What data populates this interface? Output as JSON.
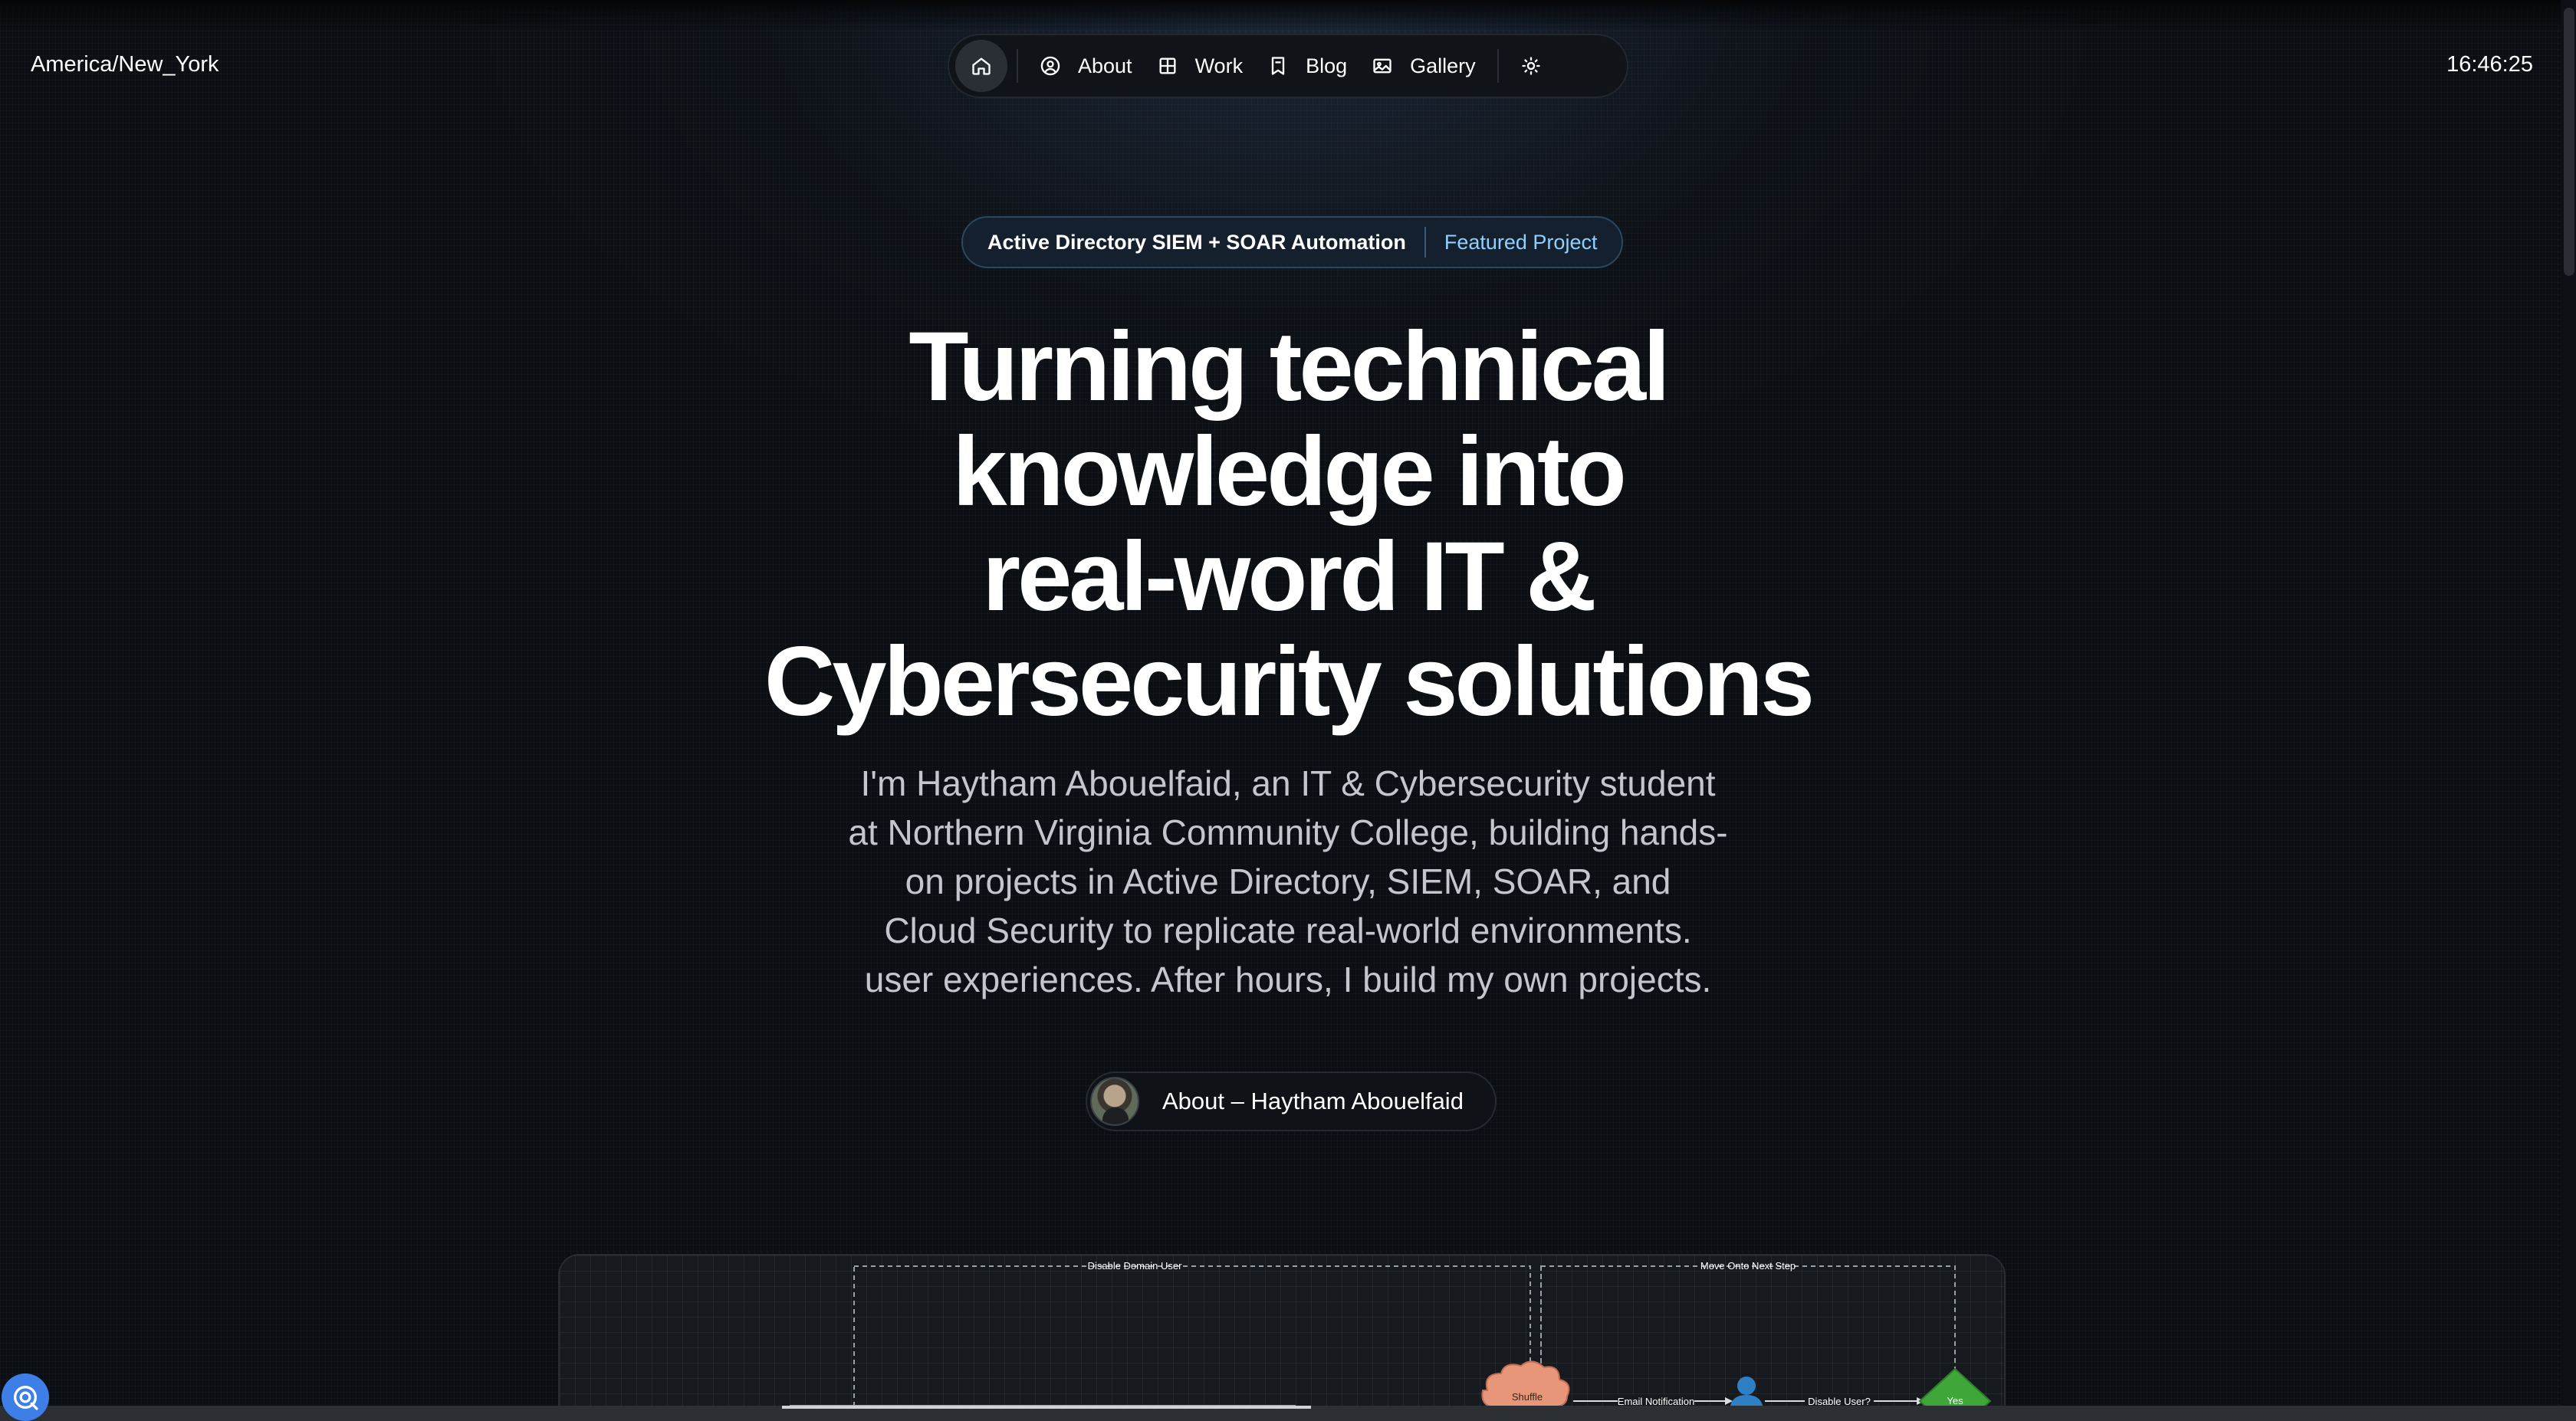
{
  "header": {
    "timezone": "America/New_York",
    "clock": "16:46:25"
  },
  "nav": {
    "items": [
      {
        "label": "About",
        "icon": "user-circle-icon"
      },
      {
        "label": "Work",
        "icon": "grid-icon"
      },
      {
        "label": "Blog",
        "icon": "book-icon"
      },
      {
        "label": "Gallery",
        "icon": "image-icon"
      }
    ],
    "home_icon": "home-icon",
    "theme_icon": "sun-icon"
  },
  "badge": {
    "title": "Active Directory SIEM + SOAR Automation",
    "tag": "Featured Project"
  },
  "hero": {
    "title_lines": [
      "Turning technical",
      "knowledge into",
      "real-word IT &",
      "Cybersecurity solutions"
    ],
    "subtitle_lines": [
      "I'm Haytham Abouelfaid, an IT & Cybersecurity student",
      "at Northern Virginia Community College, building hands-",
      "on projects in Active Directory, SIEM, SOAR, and",
      "Cloud Security to replicate real-world environments.",
      "user experiences. After hours, I build my own projects."
    ]
  },
  "about_button": {
    "label": "About – Haytham Abouelfaid"
  },
  "diagram": {
    "group_labels": [
      "Disable Domain User",
      "Move Onto Next Step"
    ],
    "nodes": [
      "Shuffle",
      "Yes"
    ],
    "edge_labels": [
      "Email Notification",
      "Disable User?"
    ]
  },
  "colors": {
    "accent_tag": "#8fd0ff",
    "background": "#0b0e12",
    "diagram_shuffle": "#e8967a",
    "diagram_user": "#2f7fc4",
    "diagram_yes": "#3fa63a",
    "floating_button": "#3d7fe6"
  }
}
